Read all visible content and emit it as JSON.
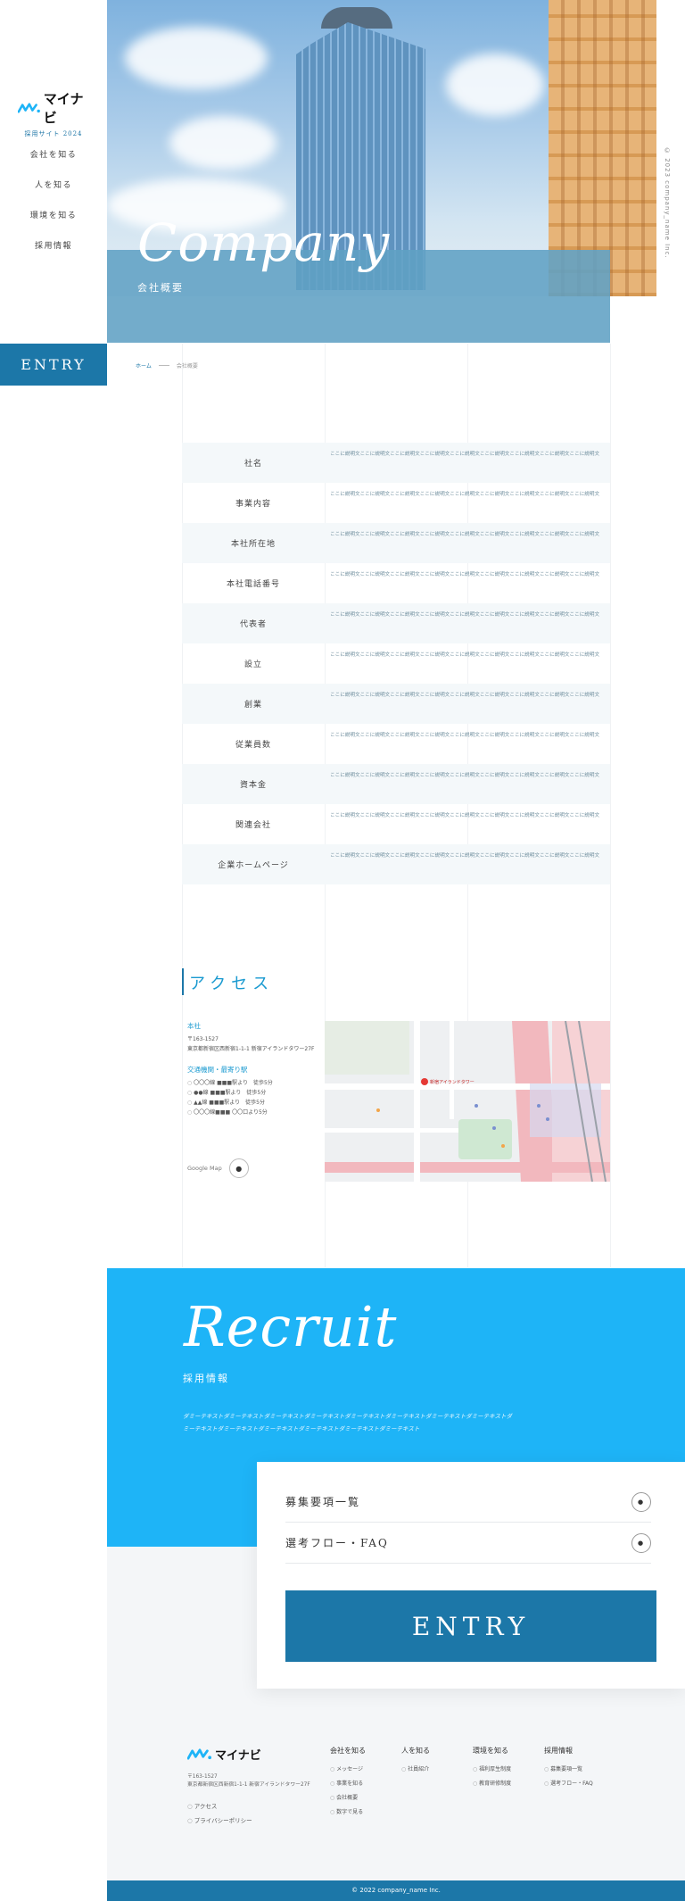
{
  "brand": {
    "logo_text": "マイナビ",
    "logo_sub": "採用サイト 2024"
  },
  "nav": [
    "会社を知る",
    "人を知る",
    "環境を知る",
    "採用情報"
  ],
  "entry_side": "ENTRY",
  "hero": {
    "script_title": "Company",
    "subtitle": "会社概要",
    "copyright_vertical": "© 2023 company_name Inc."
  },
  "breadcrumb": {
    "home": "ホーム",
    "current": "会社概要"
  },
  "company_table": {
    "rows": [
      {
        "label": "社名",
        "text": "ここに説明文ここに説明文ここに説明文ここに説明文ここに説明文ここに説明文ここに説明文ここに説明文ここに説明文"
      },
      {
        "label": "事業内容",
        "text": "ここに説明文ここに説明文ここに説明文ここに説明文ここに説明文ここに説明文ここに説明文ここに説明文ここに説明文"
      },
      {
        "label": "本社所在地",
        "text": "ここに説明文ここに説明文ここに説明文ここに説明文ここに説明文ここに説明文ここに説明文ここに説明文ここに説明文"
      },
      {
        "label": "本社電話番号",
        "text": "ここに説明文ここに説明文ここに説明文ここに説明文ここに説明文ここに説明文ここに説明文ここに説明文ここに説明文"
      },
      {
        "label": "代表者",
        "text": "ここに説明文ここに説明文ここに説明文ここに説明文ここに説明文ここに説明文ここに説明文ここに説明文ここに説明文"
      },
      {
        "label": "設立",
        "text": "ここに説明文ここに説明文ここに説明文ここに説明文ここに説明文ここに説明文ここに説明文ここに説明文ここに説明文"
      },
      {
        "label": "創業",
        "text": "ここに説明文ここに説明文ここに説明文ここに説明文ここに説明文ここに説明文ここに説明文ここに説明文ここに説明文"
      },
      {
        "label": "従業員数",
        "text": "ここに説明文ここに説明文ここに説明文ここに説明文ここに説明文ここに説明文ここに説明文ここに説明文ここに説明文"
      },
      {
        "label": "資本金",
        "text": "ここに説明文ここに説明文ここに説明文ここに説明文ここに説明文ここに説明文ここに説明文ここに説明文ここに説明文"
      },
      {
        "label": "関連会社",
        "text": "ここに説明文ここに説明文ここに説明文ここに説明文ここに説明文ここに説明文ここに説明文ここに説明文ここに説明文"
      },
      {
        "label": "企業ホームページ",
        "text": "ここに説明文ここに説明文ここに説明文ここに説明文ここに説明文ここに説明文ここに説明文ここに説明文ここに説明文"
      }
    ]
  },
  "access": {
    "title": "アクセス",
    "office_heading": "本社",
    "postal": "〒163-1527",
    "address": "東京都新宿区西新宿1-1-1 新宿アイランドタワー27F",
    "transport_heading": "交通機関・最寄り駅",
    "transport": [
      "〇〇〇線 ■■■駅より　徒歩5分",
      "●●線 ■■■駅より　徒歩5分",
      "▲▲線 ■■■駅より　徒歩5分",
      "〇〇〇線■■■ 〇〇口より5分"
    ],
    "gmaps_label": "Google Map",
    "map_pin_label": "新宿アイランドタワー"
  },
  "recruit": {
    "script_title": "Recruit",
    "subtitle": "採用情報",
    "description": "ダミーテキストダミーテキストダミーテキストダミーテキストダミーテキストダミーテキストダミーテキストダミーテキストダミーテキストダミーテキストダミーテキストダミーテキストダミーテキストダミーテキスト",
    "links": [
      "募集要項一覧",
      "選考フロー・FAQ"
    ],
    "entry": "ENTRY"
  },
  "footer": {
    "logo_text": "マイナビ",
    "postal": "〒163-1527",
    "address": "東京都新宿区西新宿1-1-1 新宿アイランドタワー27F",
    "links": [
      "アクセス",
      "プライバシーポリシー"
    ],
    "columns": [
      {
        "heading": "会社を知る",
        "items": [
          "メッセージ",
          "事業を知る",
          "会社概要",
          "数字で見る"
        ]
      },
      {
        "heading": "人を知る",
        "items": [
          "社員紹介"
        ]
      },
      {
        "heading": "環境を知る",
        "items": [
          "福利厚生制度",
          "教育研修制度"
        ]
      },
      {
        "heading": "採用情報",
        "items": [
          "募集要項一覧",
          "選考フロー・FAQ"
        ]
      }
    ],
    "copyright": "© 2022 company_name Inc."
  },
  "colors": {
    "primary": "#1c77a8",
    "recruit_bg": "#1eb4f7",
    "accent_text": "#1a9ad0"
  }
}
